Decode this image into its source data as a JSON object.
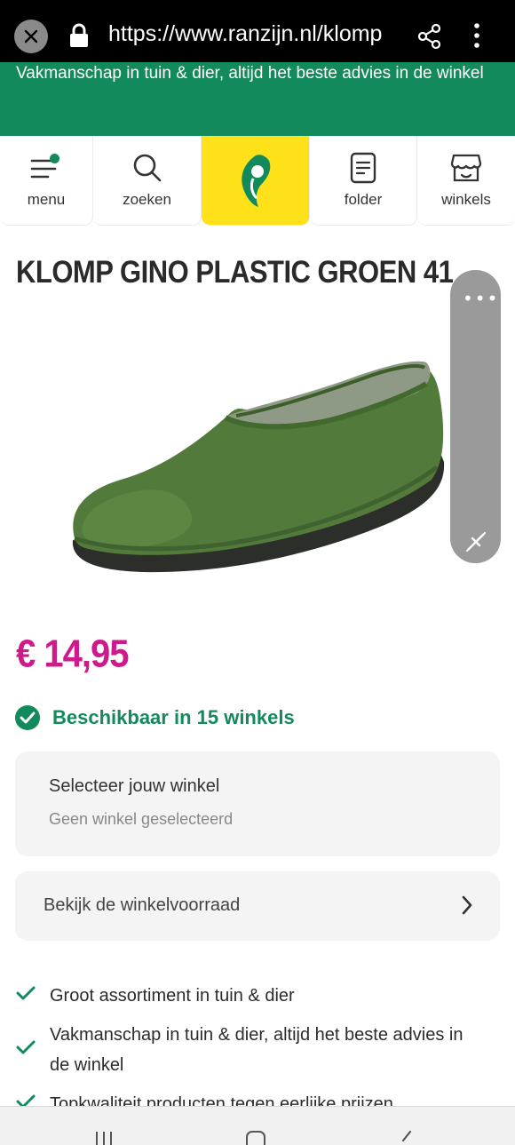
{
  "browser": {
    "url": "https://www.ranzijn.nl/klomp"
  },
  "banner": {
    "text": "Vakmanschap in tuin & dier, altijd het beste advies in de winkel"
  },
  "nav": {
    "items": [
      {
        "label": "menu",
        "icon": "menu-icon"
      },
      {
        "label": "zoeken",
        "icon": "search-icon"
      },
      {
        "label": "",
        "icon": "logo-icon"
      },
      {
        "label": "folder",
        "icon": "folder-icon"
      },
      {
        "label": "winkels",
        "icon": "store-icon"
      }
    ]
  },
  "product": {
    "title": "KLOMP GINO PLASTIC GROEN 41",
    "price": "€ 14,95",
    "availability": "Beschikbaar in 15 winkels"
  },
  "store_select": {
    "heading": "Selecteer jouw winkel",
    "subtext": "Geen winkel geselecteerd"
  },
  "stock": {
    "label": "Bekijk de winkelvoorraad"
  },
  "usps": [
    "Groot assortiment in tuin & dier",
    "Vakmanschap in tuin & dier, altijd het beste advies in de winkel",
    "Topkwaliteit producten tegen eerlijke prijzen"
  ],
  "colors": {
    "brand_green": "#138a5b",
    "brand_yellow": "#ffe11a",
    "price_magenta": "#cf1a8c"
  }
}
